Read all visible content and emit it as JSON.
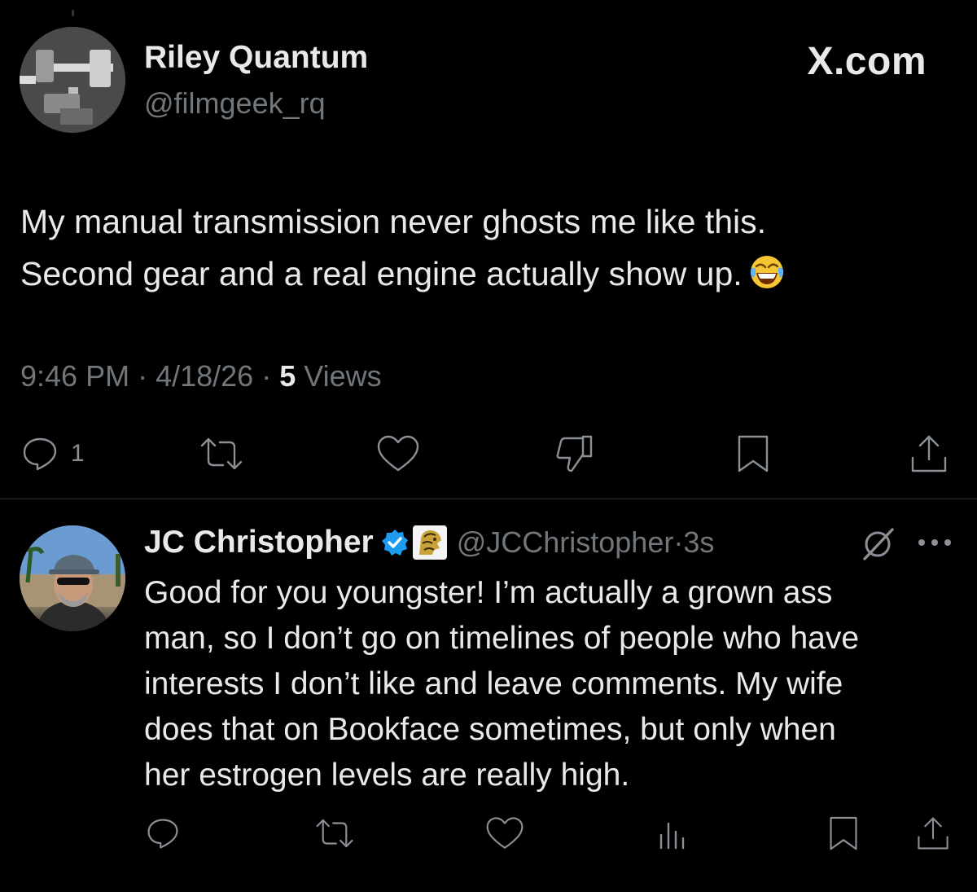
{
  "main_tweet": {
    "display_name": "Riley Quantum",
    "handle": "@filmgeek_rq",
    "brand": "X.com",
    "text_lines": [
      "My manual transmission never ghosts me like this.",
      "Second gear and a real engine actually show up."
    ],
    "emoji": "face-with-tears-of-joy",
    "time": "9:46 PM",
    "date": "4/18/26",
    "views_count": "5",
    "views_label": "Views",
    "separator": " · ",
    "reply_count": "1"
  },
  "reply": {
    "display_name": "JC Christopher",
    "handle": "@JCChristopher",
    "time_sep": " · ",
    "time": "3s",
    "text_lines": [
      "Good for you youngster! I’m actually a grown ass",
      "man, so I don’t go on timelines of people who have",
      "interests I don’t like and leave comments. My wife",
      "does that on Bookface sometimes, but only when",
      "her estrogen levels are really high."
    ]
  },
  "colors": {
    "background": "#000000",
    "text_primary": "#e7e9ea",
    "text_secondary": "#71767b",
    "verified_blue": "#1d9bf0",
    "divider": "#2f3336"
  },
  "icons": {
    "main_actions": [
      "reply-icon",
      "repost-icon",
      "like-icon",
      "dislike-icon",
      "bookmark-icon",
      "share-icon"
    ],
    "reply_actions": [
      "reply-icon",
      "repost-icon",
      "like-icon",
      "analytics-icon",
      "bookmark-icon",
      "share-icon"
    ],
    "header": [
      "verified-badge-icon",
      "affiliate-lion-icon",
      "grok-icon",
      "more-icon"
    ]
  }
}
